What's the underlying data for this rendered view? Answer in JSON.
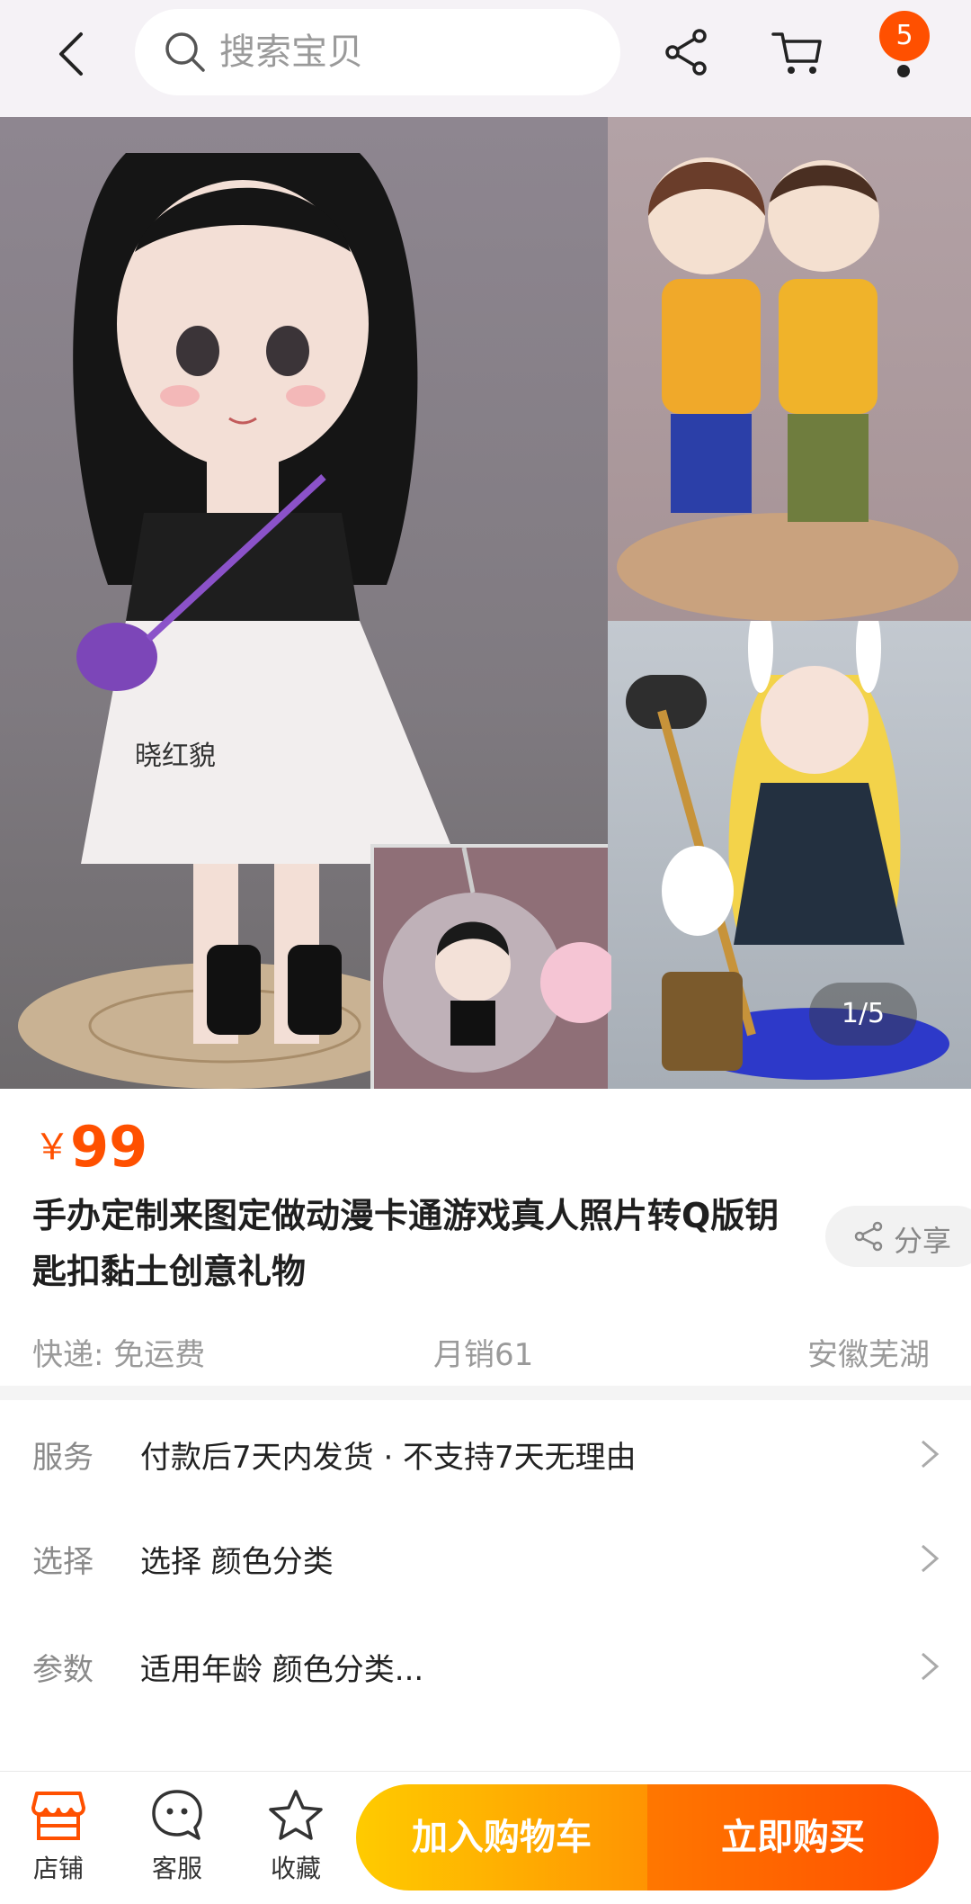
{
  "header": {
    "search_placeholder": "搜索宝贝",
    "message_count": "5"
  },
  "gallery": {
    "counter": "1/5",
    "watermark": "晓红貌"
  },
  "product": {
    "currency": "￥",
    "price": "99",
    "title": "手办定制来图定做动漫卡通游戏真人照片转Q版钥匙扣黏土创意礼物",
    "share_label": "分享",
    "shipping": "快递: 免运费",
    "monthly_sales": "月销61",
    "location": "安徽芜湖"
  },
  "options": [
    {
      "key": "服务",
      "value": "付款后7天内发货 · 不支持7天无理由"
    },
    {
      "key": "选择",
      "value": "选择 颜色分类"
    },
    {
      "key": "参数",
      "value": "适用年龄 颜色分类..."
    }
  ],
  "bottom": {
    "store_label": "店铺",
    "service_label": "客服",
    "favorite_label": "收藏",
    "add_to_cart": "加入购物车",
    "buy_now": "立即购买"
  },
  "colors": {
    "accent": "#ff5000",
    "cart_gradient": [
      "#ffcb00",
      "#ff9402"
    ],
    "buy_gradient": [
      "#ff7700",
      "#ff4e00"
    ]
  }
}
